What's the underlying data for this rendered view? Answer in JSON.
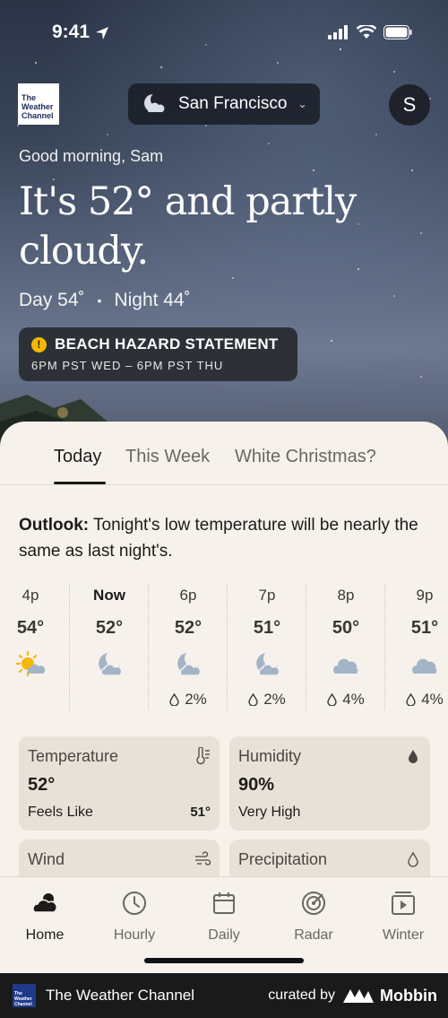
{
  "status_bar": {
    "time": "9:41"
  },
  "header": {
    "logo_text": [
      "The",
      "Weather",
      "Channel"
    ],
    "location": "San Francisco",
    "avatar_initial": "S"
  },
  "hero": {
    "greeting": "Good morning, Sam",
    "headline": "It's 52° and partly cloudy.",
    "day": "Day 54˚",
    "separator": "•",
    "night": "Night 44˚"
  },
  "alert": {
    "title": "BEACH HAZARD STATEMENT",
    "time": "6PM PST WED – 6PM PST THU",
    "badge": "!",
    "color": "#f5b800"
  },
  "tabs": [
    "Today",
    "This Week",
    "White Christmas?"
  ],
  "outlook": {
    "label": "Outlook:",
    "text": " Tonight's low temperature will be nearly the same as last night's."
  },
  "hourly": [
    {
      "time": "4p",
      "temp": "54°",
      "icon": "sun-cloud-icon",
      "precip": ""
    },
    {
      "time": "Now",
      "temp": "52°",
      "icon": "moon-cloud-icon",
      "precip": ""
    },
    {
      "time": "6p",
      "temp": "52°",
      "icon": "moon-cloud-icon",
      "precip": "2%"
    },
    {
      "time": "7p",
      "temp": "51°",
      "icon": "moon-cloud-icon",
      "precip": "2%"
    },
    {
      "time": "8p",
      "temp": "50°",
      "icon": "cloud-icon",
      "precip": "4%"
    },
    {
      "time": "9p",
      "temp": "51°",
      "icon": "cloud-icon",
      "precip": "4%"
    }
  ],
  "cards": {
    "temperature": {
      "title": "Temperature",
      "value": "52°",
      "sub_label": "Feels Like",
      "sub_value": "51°"
    },
    "humidity": {
      "title": "Humidity",
      "value": "90%",
      "sub_label": "Very High"
    },
    "wind": {
      "title": "Wind"
    },
    "precipitation": {
      "title": "Precipitation"
    }
  },
  "nav": [
    "Home",
    "Hourly",
    "Daily",
    "Radar",
    "Winter"
  ],
  "footer": {
    "brand": "The Weather Channel",
    "curated": "curated by",
    "mobbin": "Mobbin"
  },
  "colors": {
    "sheet_bg": "#f6f1eb",
    "card_bg": "#e8e1d7",
    "icon_blue": "#a3b4c6",
    "sun_yellow": "#f5b800"
  }
}
